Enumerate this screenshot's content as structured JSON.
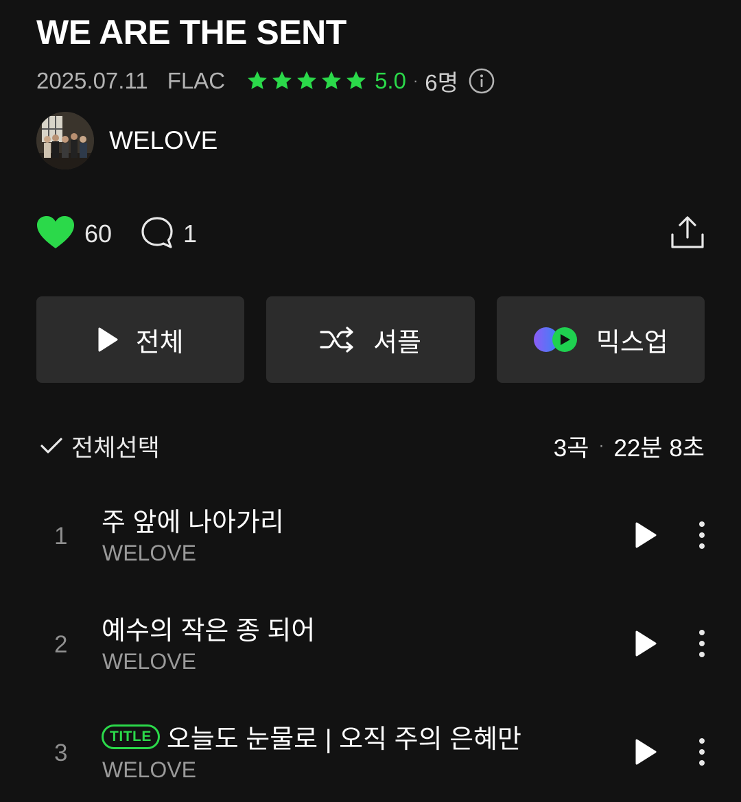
{
  "album": {
    "title": "WE ARE THE SENT",
    "release_date": "2025.07.11",
    "format": "FLAC",
    "rating": "5.0",
    "rating_stars": 5,
    "rater_count": "6명"
  },
  "artist": {
    "name": "WELOVE"
  },
  "social": {
    "like_count": "60",
    "comment_count": "1"
  },
  "actions": {
    "play_all_label": "전체",
    "shuffle_label": "셔플",
    "mixup_label": "믹스업"
  },
  "list_header": {
    "select_all_label": "전체선택",
    "track_count": "3곡",
    "total_duration": "22분 8초"
  },
  "tracks": [
    {
      "number": "1",
      "title": "주 앞에 나아가리",
      "artist": "WELOVE"
    },
    {
      "number": "2",
      "title": "예수의 작은 종 되어",
      "artist": "WELOVE"
    },
    {
      "number": "3",
      "badge": "TITLE",
      "title": "오늘도 눈물로 | 오직 주의 은혜만",
      "artist": "WELOVE"
    }
  ],
  "colors": {
    "background": "#121212",
    "accent_green": "#2bd94a",
    "button_bg": "#2c2c2c"
  },
  "icons": [
    "star-icon",
    "info-icon",
    "heart-icon",
    "comment-icon",
    "share-icon",
    "play-icon",
    "shuffle-icon",
    "mixup-icon",
    "check-icon",
    "more-vertical-icon"
  ]
}
